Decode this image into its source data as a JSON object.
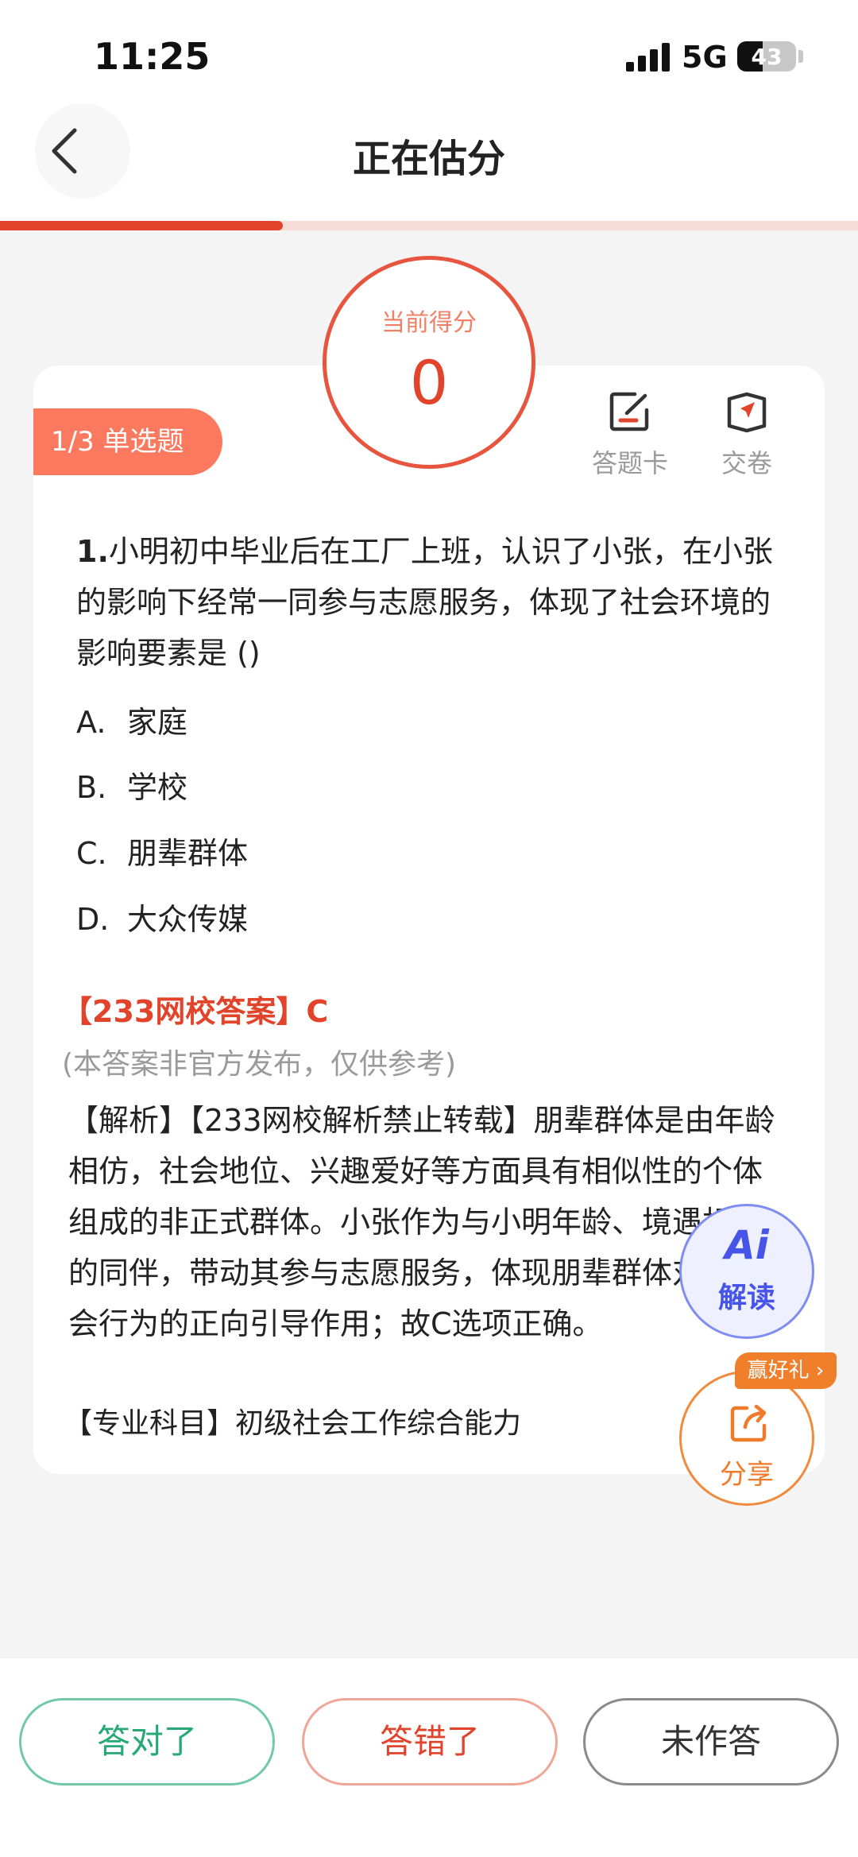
{
  "status_bar": {
    "time": "11:25",
    "network": "5G",
    "battery": "43",
    "battery_level": 0.43
  },
  "header": {
    "title": "正在估分",
    "progress": 0.33
  },
  "score": {
    "label": "当前得分",
    "value": "0"
  },
  "question_meta": {
    "type_badge": "1/3  单选题"
  },
  "tools": {
    "answer_card_label": "答题卡",
    "submit_label": "交卷"
  },
  "question": {
    "number": "1.",
    "text": "小明初中毕业后在工厂上班，认识了小张，在小张的影响下经常一同参与志愿服务，体现了社会环境的影响要素是 ()",
    "options": [
      {
        "letter": "A.",
        "text": "家庭"
      },
      {
        "letter": "B.",
        "text": "学校"
      },
      {
        "letter": "C.",
        "text": "朋辈群体"
      },
      {
        "letter": "D.",
        "text": "大众传媒"
      }
    ]
  },
  "answer": {
    "line": "【233网校答案】C",
    "disclaimer": "(本答案非官方发布，仅供参考)",
    "analysis": "【解析】【233网校解析禁止转载】朋辈群体是由年龄相仿，社会地位、兴趣爱好等方面具有相似性的个体组成的非正式群体。小张作为与小明年龄、境遇相似的同伴，带动其参与志愿服务，体现朋辈群体对亲社会行为的正向引导作用；故C选项正确。",
    "subject": "【专业科目】初级社会工作综合能力"
  },
  "floating": {
    "ai_logo": "Ai",
    "ai_label": "解读",
    "share_label": "分享",
    "gift_tag": "赢好礼 ›"
  },
  "bottom": {
    "correct_label": "答对了",
    "wrong_label": "答错了",
    "unanswered_label": "未作答"
  },
  "colors": {
    "accent": "#e2432b",
    "badge": "#fb7a5f",
    "correct": "#26a877",
    "ai": "#4654e8",
    "share": "#ee7a2a"
  }
}
